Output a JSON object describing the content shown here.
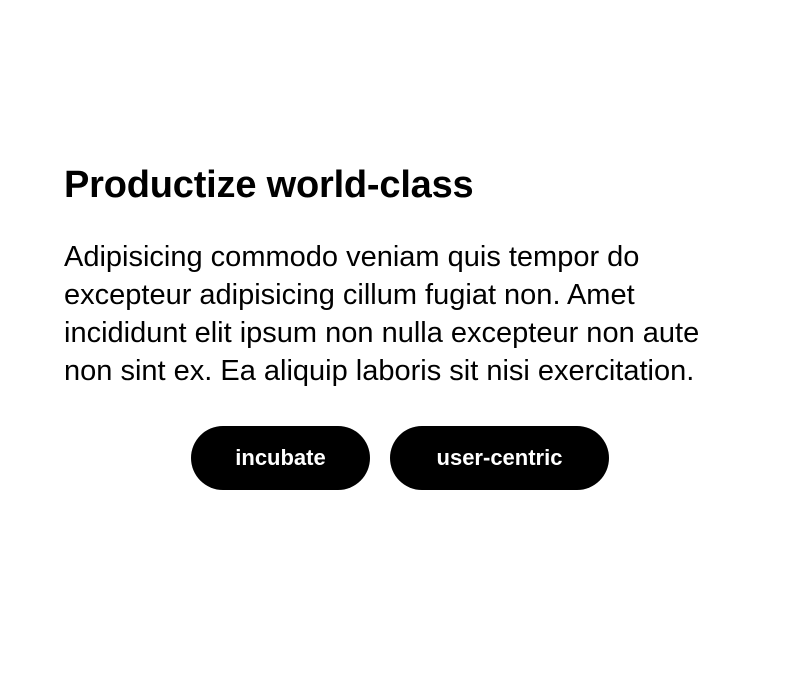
{
  "content": {
    "title": "Productize world-class",
    "body": "Adipisicing commodo veniam quis tempor do excepteur adipisicing cillum fugiat non. Amet incididunt elit ipsum non nulla excepteur non aute non sint ex. Ea aliquip laboris sit nisi exercitation."
  },
  "actions": {
    "primary_label": "incubate",
    "secondary_label": "user-centric"
  },
  "colors": {
    "background": "#ffffff",
    "text": "#000000",
    "button_bg": "#000000",
    "button_text": "#ffffff"
  }
}
